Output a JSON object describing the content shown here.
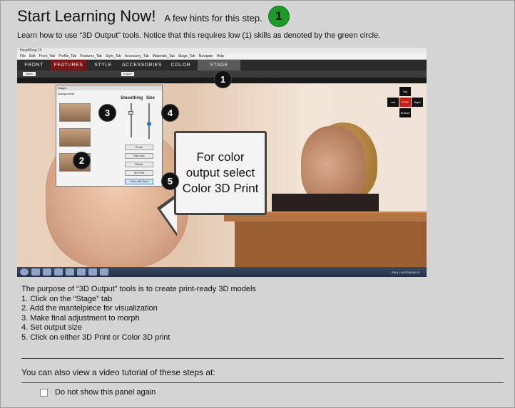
{
  "header": {
    "title": "Start Learning Now!",
    "subtitle": "A few hints for this step.",
    "skill_badge": "1",
    "skill_color": "#1e9a2a"
  },
  "intro": "Learn how to use “3D Output” tools. Notice that this requires low (1) skills as denoted by the green circle.",
  "screenshot": {
    "app_title": "HeadShop 10",
    "menu": [
      "File",
      "Edit",
      "Front_Tab",
      "Profile_Tab",
      "Features_Tab",
      "Style_Tab",
      "Accessory_Tab",
      "Materials_Tab",
      "Stage_Tab",
      "Navigate",
      "Help"
    ],
    "tabs": [
      "Front",
      "Features",
      "Style",
      "Accessories",
      "Color",
      "Stage"
    ],
    "toolbar": {
      "open": "Open",
      "export": "Export"
    },
    "stages_panel": {
      "title": "Stages",
      "list_label": "Backgrounds",
      "smoothing": "Smoothing",
      "size": "Size",
      "buttons": [
        "Photo",
        "Add new",
        "Delete",
        "3D Print",
        "Color 3D Print"
      ]
    },
    "callout": "For color output select Color 3D Print",
    "badges": [
      "1",
      "2",
      "3",
      "4",
      "5"
    ],
    "nav_pad": {
      "top": "Top",
      "left": "Left",
      "stop": "STOP",
      "right": "Right",
      "bottom": "Bottom"
    },
    "tray": "EN ▴ 1:49 2016.08.15"
  },
  "steps": {
    "intro": "The purpose of “3D Output” tools is to create print-ready 3D models",
    "items": [
      "1. Click on the “Stage” tab",
      "2. Add the mantelpiece for visualization",
      "3. Make final adjustment to morph",
      "4. Set output size",
      "5. Click on either 3D Print or Color 3D print"
    ]
  },
  "video_text": "You can also view a video tutorial of these steps at:",
  "checkbox_label": "Do not show this panel again"
}
